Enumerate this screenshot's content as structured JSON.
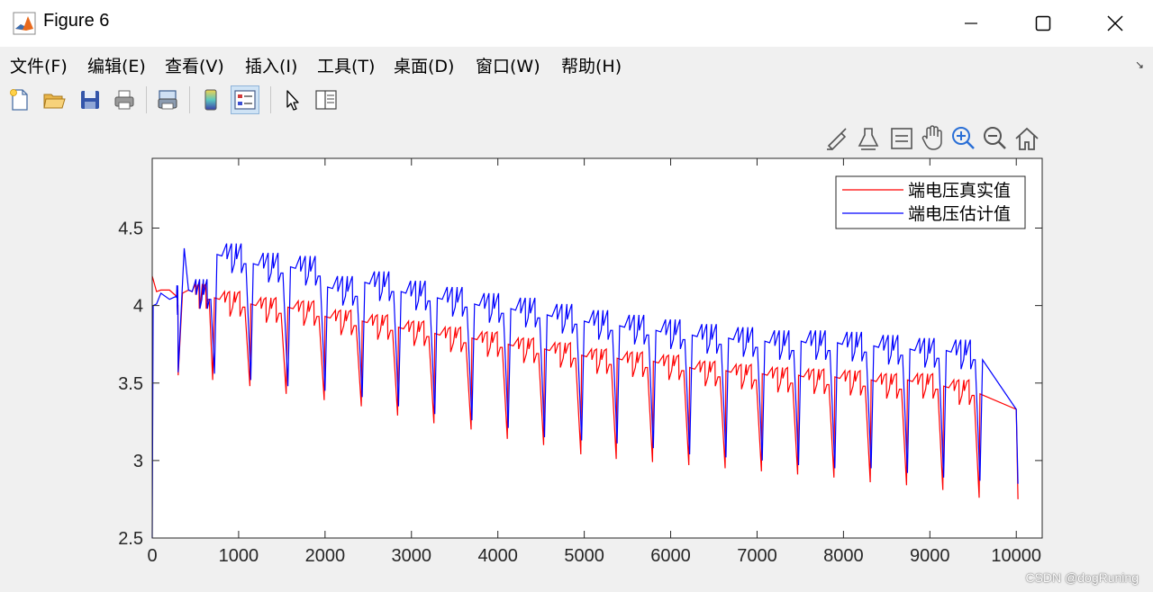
{
  "window": {
    "title": "Figure 6",
    "minimize_icon": "minimize-icon",
    "maximize_icon": "maximize-icon",
    "close_icon": "close-icon"
  },
  "menubar": {
    "items": [
      {
        "label": "文件(F)"
      },
      {
        "label": "编辑(E)"
      },
      {
        "label": "查看(V)"
      },
      {
        "label": "插入(I)"
      },
      {
        "label": "工具(T)"
      },
      {
        "label": "桌面(D)"
      },
      {
        "label": "窗口(W)"
      },
      {
        "label": "帮助(H)"
      }
    ],
    "arrow": "↘"
  },
  "toolbar": {
    "buttons": [
      "new-figure-icon",
      "open-file-icon",
      "save-icon",
      "print-icon",
      "link-plot-icon",
      "colorbar-icon",
      "legend-icon",
      "edit-plot-icon",
      "property-inspector-icon"
    ],
    "active": "legend-icon"
  },
  "axes_toolbar": {
    "buttons": [
      "brush-icon",
      "data-tips-icon",
      "legend-toggle-icon",
      "pan-icon",
      "zoom-in-icon",
      "zoom-out-icon",
      "home-icon"
    ]
  },
  "colors": {
    "true_voltage": "#ff0000",
    "estimated_voltage": "#0000ff",
    "axes_bg": "#ffffff",
    "figure_bg": "#f0f0f0"
  },
  "chart_data": {
    "type": "line",
    "title": "",
    "xlabel": "",
    "ylabel": "",
    "xlim": [
      0,
      10300
    ],
    "ylim": [
      2.5,
      4.95
    ],
    "xticks": [
      0,
      1000,
      2000,
      3000,
      4000,
      5000,
      6000,
      7000,
      8000,
      9000,
      10000
    ],
    "yticks": [
      2.5,
      3,
      3.5,
      4,
      4.5
    ],
    "xtick_labels": [
      "0",
      "1000",
      "2000",
      "3000",
      "4000",
      "5000",
      "6000",
      "7000",
      "8000",
      "9000",
      "10000"
    ],
    "ytick_labels": [
      "2.5",
      "3",
      "3.5",
      "4",
      "4.5"
    ],
    "grid": false,
    "legend": {
      "placement": "top-right",
      "entries": [
        "端电压真实值",
        "端电压估计值"
      ]
    },
    "series": [
      {
        "name": "端电压真实值",
        "color": "#ff0000",
        "description_points": {
          "x": [
            0,
            50,
            100,
            200,
            280,
            300,
            350,
            420,
            700,
            720,
            1130,
            1140,
            1550,
            1570,
            1990,
            2000,
            2420,
            2430,
            2840,
            2850,
            3260,
            3270,
            3690,
            3700,
            4110,
            4120,
            4530,
            4540,
            4960,
            4970,
            5370,
            5380,
            5790,
            5800,
            6210,
            6220,
            6630,
            6640,
            7050,
            7060,
            7470,
            7480,
            7890,
            7900,
            8310,
            8320,
            8730,
            8740,
            9150,
            9160,
            9570,
            9580,
            10000,
            10020
          ],
          "y": [
            4.19,
            4.09,
            4.1,
            4.1,
            4.06,
            3.55,
            4.08,
            4.1,
            3.52,
            4.05,
            3.48,
            4.01,
            3.43,
            3.99,
            3.39,
            3.93,
            3.35,
            3.9,
            3.29,
            3.86,
            3.24,
            3.82,
            3.2,
            3.79,
            3.14,
            3.75,
            3.1,
            3.72,
            3.04,
            3.68,
            3.01,
            3.66,
            2.99,
            3.64,
            2.97,
            3.6,
            2.95,
            3.58,
            2.93,
            3.56,
            2.91,
            3.55,
            2.89,
            3.54,
            2.86,
            3.52,
            2.84,
            3.52,
            2.81,
            3.48,
            2.76,
            3.43,
            3.33,
            2.75
          ]
        }
      },
      {
        "name": "端电压估计值",
        "color": "#0000ff",
        "description_points": {
          "x": [
            0,
            10,
            50,
            100,
            200,
            280,
            300,
            370,
            420,
            720,
            750,
            1140,
            1170,
            1570,
            1600,
            2000,
            2030,
            2430,
            2460,
            2850,
            2880,
            3270,
            3300,
            3700,
            3730,
            4120,
            4150,
            4540,
            4570,
            4970,
            5000,
            5380,
            5410,
            5800,
            5830,
            6220,
            6250,
            6640,
            6670,
            7060,
            7090,
            7480,
            7510,
            7900,
            7930,
            8320,
            8350,
            8740,
            8770,
            9160,
            9190,
            9580,
            9610,
            10000,
            10020
          ],
          "y": [
            2.5,
            4.0,
            4.01,
            4.08,
            4.04,
            4.06,
            3.57,
            4.37,
            4.1,
            3.56,
            4.33,
            3.52,
            4.27,
            3.48,
            4.25,
            3.45,
            4.12,
            3.41,
            4.15,
            3.35,
            4.09,
            3.3,
            4.05,
            3.26,
            4.01,
            3.21,
            3.98,
            3.15,
            3.94,
            3.13,
            3.9,
            3.11,
            3.87,
            3.08,
            3.84,
            3.04,
            3.81,
            3.02,
            3.79,
            3.0,
            3.77,
            2.97,
            3.77,
            2.95,
            3.76,
            2.95,
            3.74,
            2.92,
            3.72,
            2.89,
            3.71,
            2.87,
            3.65,
            3.33,
            2.85
          ]
        }
      }
    ]
  },
  "watermark": "CSDN @dogRuning"
}
